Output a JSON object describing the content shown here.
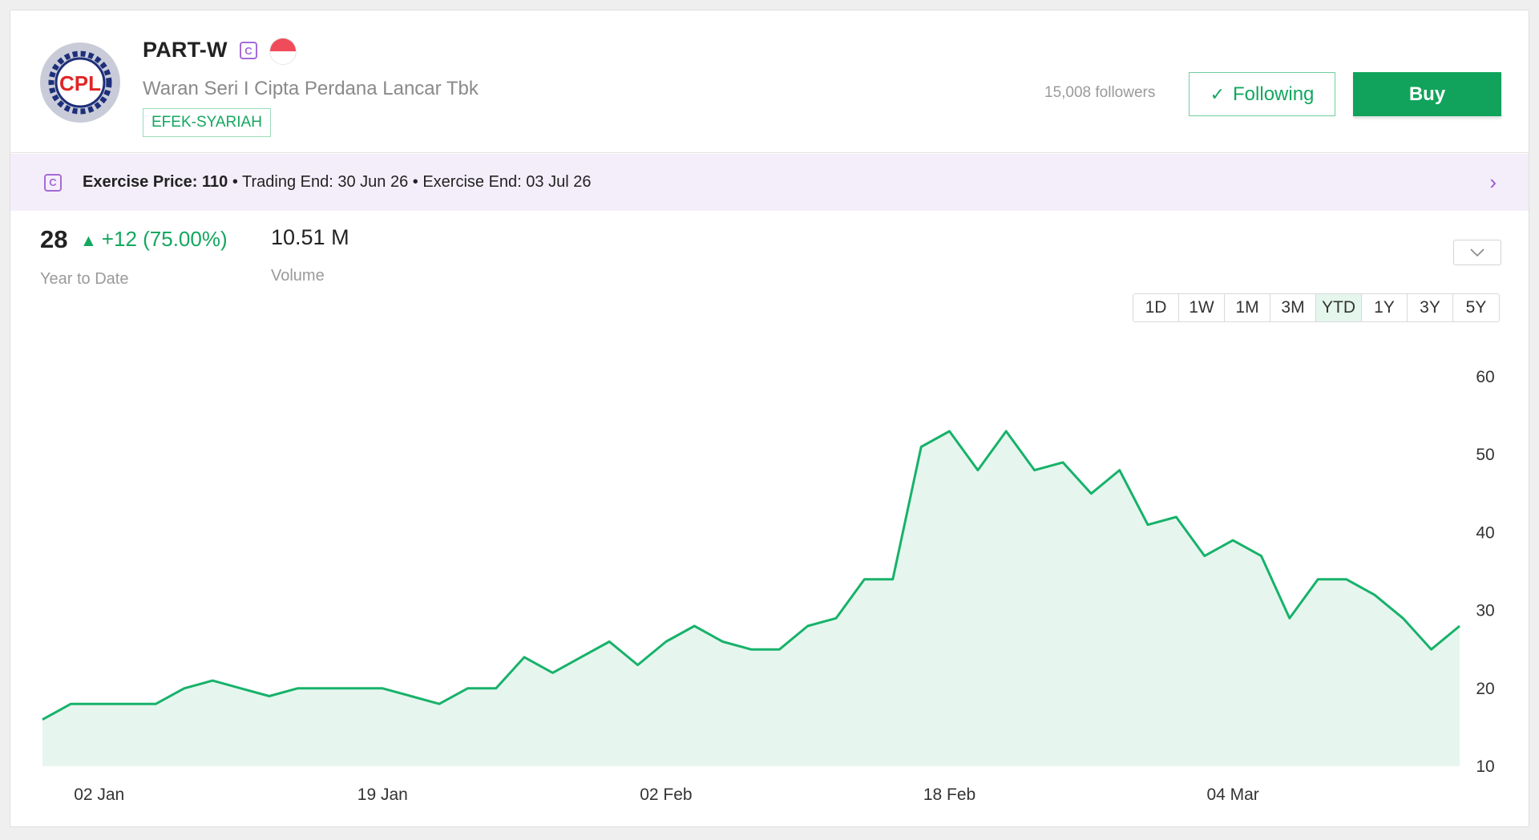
{
  "header": {
    "logo_text": "CPL",
    "ticker": "PART-W",
    "category_badge": "C",
    "country_flag": "indonesia-flag-icon",
    "company_name": "Waran Seri I Cipta Perdana Lancar Tbk",
    "tag": "EFEK-SYARIAH",
    "followers": "15,008 followers",
    "following_label": "Following",
    "buy_label": "Buy"
  },
  "info_strip": {
    "badge": "C",
    "exercise_label": "Exercise Price: 110",
    "trading_end": " • Trading End: 30 Jun 26",
    "exercise_end": " • Exercise End: 03 Jul 26"
  },
  "stats": {
    "price": "28",
    "change": "+12 (75.00%)",
    "period_label": "Year to Date",
    "volume": "10.51 M",
    "volume_label": "Volume"
  },
  "ranges": [
    "1D",
    "1W",
    "1M",
    "3M",
    "YTD",
    "1Y",
    "3Y",
    "5Y"
  ],
  "active_range": "YTD",
  "colors": {
    "green": "#11a35b",
    "line": "#17b26a",
    "area_fill": "#e6f6ee",
    "purple": "#a46ad6",
    "strip_bg": "#f4eefa"
  },
  "chart_data": {
    "type": "area",
    "title": "",
    "xlabel": "",
    "ylabel": "",
    "ylim": [
      10,
      60
    ],
    "yticks": [
      60,
      50,
      40,
      30,
      20,
      10
    ],
    "x_tick_labels": [
      {
        "label": "02 Jan",
        "index": 2
      },
      {
        "label": "19 Jan",
        "index": 12
      },
      {
        "label": "02 Feb",
        "index": 22
      },
      {
        "label": "18 Feb",
        "index": 32
      },
      {
        "label": "04 Mar",
        "index": 42
      }
    ],
    "grid": false,
    "series": [
      {
        "values": [
          16,
          18,
          18,
          18,
          18,
          20,
          21,
          20,
          19,
          20,
          20,
          20,
          20,
          19,
          18,
          20,
          20,
          24,
          22,
          24,
          26,
          23,
          26,
          28,
          26,
          25,
          25,
          28,
          29,
          34,
          34,
          51,
          53,
          48,
          53,
          48,
          49,
          45,
          48,
          41,
          42,
          37,
          39,
          37,
          29,
          34,
          34,
          32,
          29,
          25,
          28
        ]
      }
    ]
  }
}
